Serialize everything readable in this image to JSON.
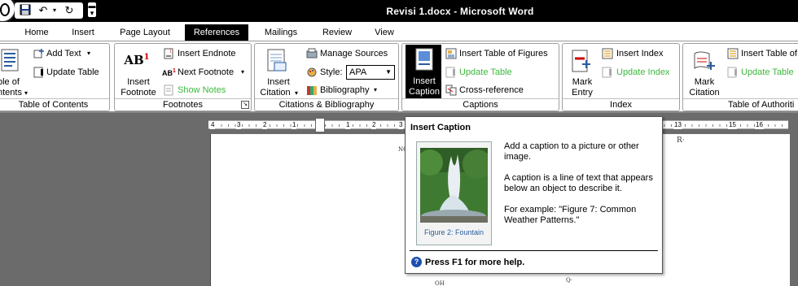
{
  "window": {
    "title": "Revisi 1.docx - Microsoft Word"
  },
  "quick_access": {
    "save_icon": "save-icon",
    "undo_icon": "undo-icon",
    "redo_icon": "redo-icon",
    "more_icon": "customize-qat-icon"
  },
  "tabs": [
    {
      "label": "Home"
    },
    {
      "label": "Insert"
    },
    {
      "label": "Page Layout"
    },
    {
      "label": "References",
      "active": true
    },
    {
      "label": "Mailings"
    },
    {
      "label": "Review"
    },
    {
      "label": "View"
    }
  ],
  "ribbon": {
    "toc": {
      "label": "Table of Contents",
      "toc_button_line1": "ble of",
      "toc_button_line2": "ntents",
      "add_text": "Add Text",
      "update_table": "Update Table"
    },
    "footnotes": {
      "label": "Footnotes",
      "insert_footnote_line1": "Insert",
      "insert_footnote_line2": "Footnote",
      "ab_glyph": "AB",
      "sup_glyph": "1",
      "insert_endnote": "Insert Endnote",
      "next_footnote": "Next Footnote",
      "show_notes": "Show Notes"
    },
    "citations": {
      "label": "Citations & Bibliography",
      "insert_citation_line1": "Insert",
      "insert_citation_line2": "Citation",
      "manage_sources": "Manage Sources",
      "style_label": "Style:",
      "style_value": "APA",
      "bibliography": "Bibliography"
    },
    "captions": {
      "label": "Captions",
      "insert_caption_line1": "Insert",
      "insert_caption_line2": "Caption",
      "insert_table_of_figures": "Insert Table of Figures",
      "update_table": "Update Table",
      "cross_reference": "Cross-reference"
    },
    "index": {
      "label": "Index",
      "mark_entry_line1": "Mark",
      "mark_entry_line2": "Entry",
      "insert_index": "Insert Index",
      "update_index": "Update Index"
    },
    "authorities": {
      "label": "Table of Authoriti",
      "mark_citation_line1": "Mark",
      "mark_citation_line2": "Citation",
      "insert_table": "Insert Table of",
      "update_table": "Update Table"
    }
  },
  "ruler": {
    "numbers": [
      "4",
      "3",
      "2",
      "1",
      "1",
      "2",
      "3",
      "13",
      "15",
      "16"
    ]
  },
  "document": {
    "marks": [
      "NO",
      "R·",
      "OH",
      "Q·"
    ]
  },
  "tooltip": {
    "title": "Insert Caption",
    "figure_caption": "Figure 2: Fountain",
    "para1": "Add a caption to a picture or other image.",
    "para2": "A caption is a line of text that appears below an object to describe it.",
    "para3": "For example: \"Figure 7: Common Weather Patterns.\"",
    "help": "Press F1 for more help."
  },
  "colors": {
    "accent_green": "#3cb83c",
    "title_bar": "#000000",
    "caption_blue": "#2a5d9f"
  }
}
